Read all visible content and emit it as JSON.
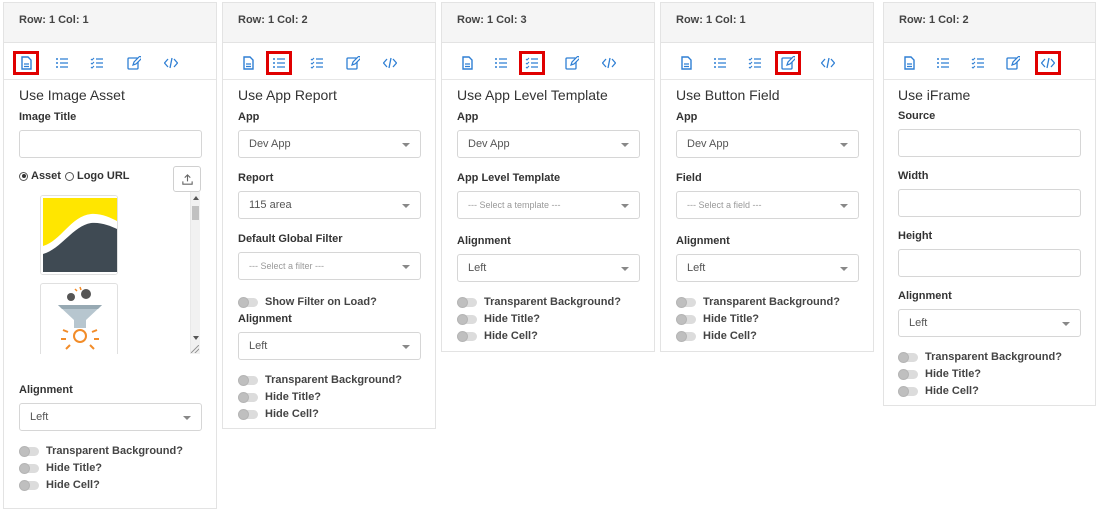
{
  "colors": {
    "icon": "#2f7fd4",
    "highlight": "#e00000",
    "border": "#e3e3e3"
  },
  "toolbar_icons": [
    "image-asset-icon",
    "app-report-icon",
    "app-level-template-icon",
    "button-field-icon",
    "iframe-icon"
  ],
  "panel1": {
    "header": "Row: 1 Col: 1",
    "title": "Use Image Asset",
    "image_title_label": "Image Title",
    "image_title_value": "",
    "radio_asset": "Asset",
    "radio_logo_url": "Logo URL",
    "alignment_label": "Alignment",
    "alignment_value": "Left",
    "toggles": [
      "Transparent Background?",
      "Hide Title?",
      "Hide Cell?"
    ]
  },
  "panel2": {
    "header": "Row: 1 Col: 2",
    "title": "Use App Report",
    "app_label": "App",
    "app_value": "Dev App",
    "report_label": "Report",
    "report_value": "115 area",
    "filter_label": "Default Global Filter",
    "filter_placeholder": "--- Select a filter ---",
    "show_filter_label": "Show Filter on Load?",
    "alignment_label": "Alignment",
    "alignment_value": "Left",
    "toggles": [
      "Transparent Background?",
      "Hide Title?",
      "Hide Cell?"
    ]
  },
  "panel3": {
    "header": "Row: 1 Col: 3",
    "title": "Use App Level Template",
    "app_label": "App",
    "app_value": "Dev App",
    "template_label": "App Level Template",
    "template_placeholder": "--- Select a template ---",
    "alignment_label": "Alignment",
    "alignment_value": "Left",
    "toggles": [
      "Transparent Background?",
      "Hide Title?",
      "Hide Cell?"
    ]
  },
  "panel4": {
    "header": "Row: 1 Col: 1",
    "title": "Use Button Field",
    "app_label": "App",
    "app_value": "Dev App",
    "field_label": "Field",
    "field_placeholder": "--- Select a field ---",
    "alignment_label": "Alignment",
    "alignment_value": "Left",
    "toggles": [
      "Transparent Background?",
      "Hide Title?",
      "Hide Cell?"
    ]
  },
  "panel5": {
    "header": "Row: 1 Col: 2",
    "title": "Use iFrame",
    "source_label": "Source",
    "source_value": "",
    "width_label": "Width",
    "width_value": "",
    "height_label": "Height",
    "height_value": "",
    "alignment_label": "Alignment",
    "alignment_value": "Left",
    "toggles": [
      "Transparent Background?",
      "Hide Title?",
      "Hide Cell?"
    ]
  }
}
